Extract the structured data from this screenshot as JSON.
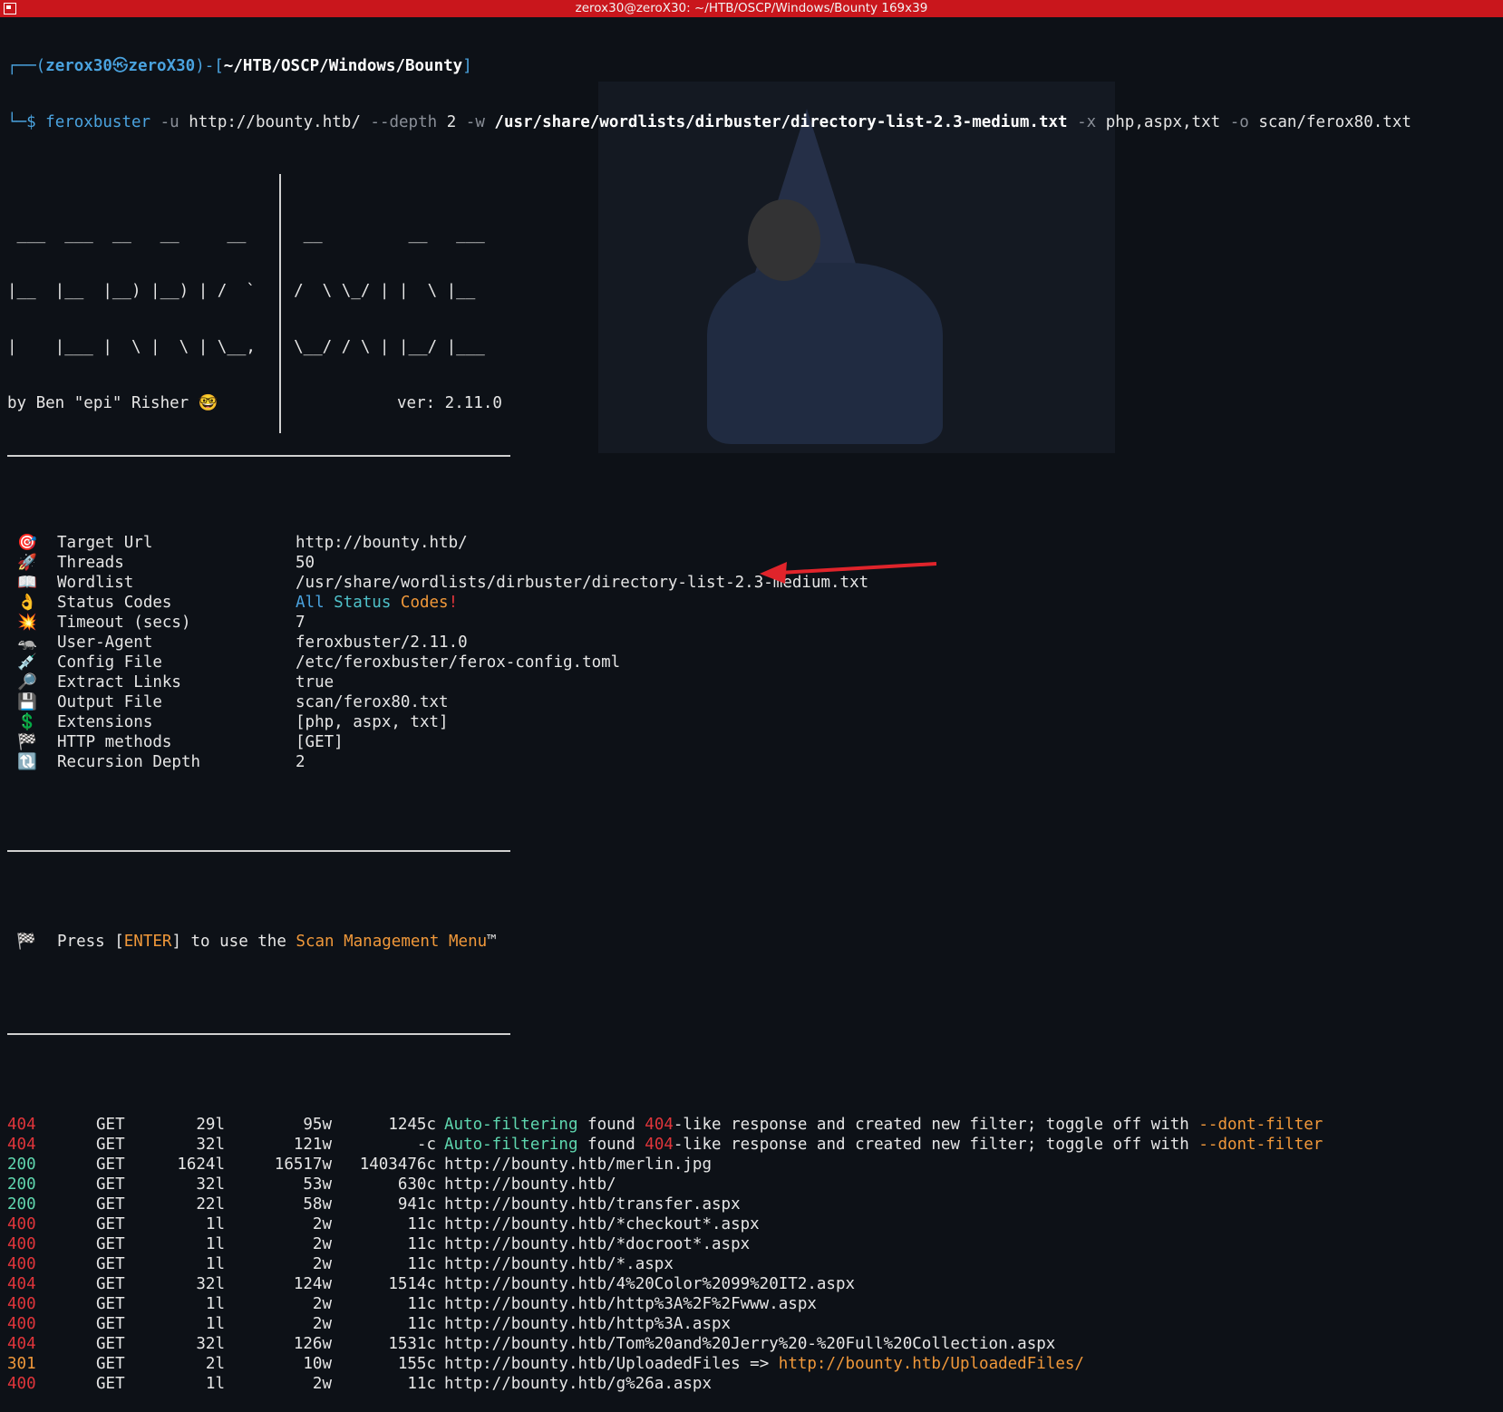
{
  "window": {
    "title": "zerox30@zeroX30: ~/HTB/OSCP/Windows/Bounty 169x39"
  },
  "prompt": {
    "open": "┌──(",
    "user": "zerox30",
    "at": "㉿",
    "host": "zeroX30",
    "mid": ")-[",
    "path": "~/HTB/OSCP/Windows/Bounty",
    "close": "]",
    "cmd_prefix": "└─$ ",
    "cmd_bin": "feroxbuster",
    "cmd_u": " -u ",
    "cmd_url": "http://bounty.htb/",
    "cmd_depth": " --depth ",
    "cmd_depth_val": "2",
    "cmd_w": " -w ",
    "cmd_wordlist": "/usr/share/wordlists/dirbuster/directory-list-2.3-medium.txt",
    "cmd_x": " -x ",
    "cmd_ext": "php,aspx,txt",
    "cmd_o": " -o ",
    "cmd_out": "scan/ferox80.txt"
  },
  "banner": {
    "art1": " ___  ___  __   __     __      __         __   ___",
    "art2": "|__  |__  |__) |__) | /  `    /  \\ \\_/ | |  \\ |__",
    "art3": "|    |___ |  \\ |  \\ | \\__,    \\__/ / \\ | |__/ |___",
    "byline": "by Ben \"epi\" Risher 🤓",
    "version": "ver: 2.11.0"
  },
  "config": [
    {
      "icon": "🎯",
      "key": "Target Url",
      "value": "http://bounty.htb/"
    },
    {
      "icon": "🚀",
      "key": "Threads",
      "value": "50"
    },
    {
      "icon": "📖",
      "key": "Wordlist",
      "value": "/usr/share/wordlists/dirbuster/directory-list-2.3-medium.txt"
    },
    {
      "icon": "👌",
      "key": "Status Codes",
      "value": ""
    },
    {
      "icon": "💥",
      "key": "Timeout (secs)",
      "value": "7"
    },
    {
      "icon": "🦡",
      "key": "User-Agent",
      "value": "feroxbuster/2.11.0"
    },
    {
      "icon": "💉",
      "key": "Config File",
      "value": "/etc/feroxbuster/ferox-config.toml"
    },
    {
      "icon": "🔎",
      "key": "Extract Links",
      "value": "true"
    },
    {
      "icon": "💾",
      "key": "Output File",
      "value": "scan/ferox80.txt"
    },
    {
      "icon": "💲",
      "key": "Extensions",
      "value": "[php, aspx, txt]"
    },
    {
      "icon": "🏁",
      "key": "HTTP methods",
      "value": "[GET]"
    },
    {
      "icon": "🔃",
      "key": "Recursion Depth",
      "value": "2"
    }
  ],
  "status_codes": {
    "all": "All",
    "status": " Status",
    "codes": " Codes",
    "bang": "!"
  },
  "press": {
    "icon": "🏁",
    "pre": "Press [",
    "enter": "ENTER",
    "mid": "] to use the ",
    "menu": "Scan Management Menu",
    "tm": "™"
  },
  "results": [
    {
      "status": "404",
      "method": "GET",
      "lines": "29l",
      "words": "95w",
      "chars": "1245c",
      "kind": "filter"
    },
    {
      "status": "404",
      "method": "GET",
      "lines": "32l",
      "words": "121w",
      "chars": "-c",
      "kind": "filter"
    },
    {
      "status": "200",
      "method": "GET",
      "lines": "1624l",
      "words": "16517w",
      "chars": "1403476c",
      "url": "http://bounty.htb/merlin.jpg"
    },
    {
      "status": "200",
      "method": "GET",
      "lines": "32l",
      "words": "53w",
      "chars": "630c",
      "url": "http://bounty.htb/"
    },
    {
      "status": "200",
      "method": "GET",
      "lines": "22l",
      "words": "58w",
      "chars": "941c",
      "url": "http://bounty.htb/transfer.aspx"
    },
    {
      "status": "400",
      "method": "GET",
      "lines": "1l",
      "words": "2w",
      "chars": "11c",
      "url": "http://bounty.htb/*checkout*.aspx"
    },
    {
      "status": "400",
      "method": "GET",
      "lines": "1l",
      "words": "2w",
      "chars": "11c",
      "url": "http://bounty.htb/*docroot*.aspx"
    },
    {
      "status": "400",
      "method": "GET",
      "lines": "1l",
      "words": "2w",
      "chars": "11c",
      "url": "http://bounty.htb/*.aspx"
    },
    {
      "status": "404",
      "method": "GET",
      "lines": "32l",
      "words": "124w",
      "chars": "1514c",
      "url": "http://bounty.htb/4%20Color%2099%20IT2.aspx"
    },
    {
      "status": "400",
      "method": "GET",
      "lines": "1l",
      "words": "2w",
      "chars": "11c",
      "url": "http://bounty.htb/http%3A%2F%2Fwww.aspx"
    },
    {
      "status": "400",
      "method": "GET",
      "lines": "1l",
      "words": "2w",
      "chars": "11c",
      "url": "http://bounty.htb/http%3A.aspx"
    },
    {
      "status": "404",
      "method": "GET",
      "lines": "32l",
      "words": "126w",
      "chars": "1531c",
      "url": "http://bounty.htb/Tom%20and%20Jerry%20-%20Full%20Collection.aspx"
    },
    {
      "status": "301",
      "method": "GET",
      "lines": "2l",
      "words": "10w",
      "chars": "155c",
      "url": "http://bounty.htb/UploadedFiles",
      "redirect_arrow": " => ",
      "redirect": "http://bounty.htb/UploadedFiles/"
    },
    {
      "status": "400",
      "method": "GET",
      "lines": "1l",
      "words": "2w",
      "chars": "11c",
      "url": "http://bounty.htb/g%26a.aspx"
    }
  ],
  "filter_msg": {
    "auto": "Auto-filtering",
    "found": " found ",
    "code": "404",
    "rest": "-like response and created new filter; toggle off with ",
    "flag": "--dont-filter"
  },
  "colors": {
    "titlebar": "#c9161c",
    "background": "#0d1117",
    "ok": "#5fd7af",
    "error": "#e0353b",
    "redirect": "#f0983a",
    "arrow": "#e0242b"
  }
}
